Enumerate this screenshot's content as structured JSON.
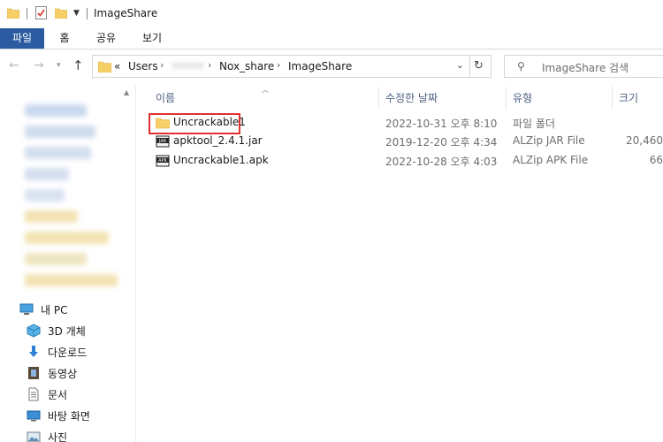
{
  "window": {
    "title": "ImageShare"
  },
  "ribbon": {
    "tabs": [
      "파일",
      "홈",
      "공유",
      "보기"
    ]
  },
  "address": {
    "overflow": "«",
    "crumbs": [
      "Users",
      "•••••",
      "Nox_share",
      "ImageShare"
    ],
    "separator": "›"
  },
  "search": {
    "placeholder": "ImageShare 검색"
  },
  "columns": {
    "name": "이름",
    "date": "수정한 날짜",
    "type": "유형",
    "size": "크기"
  },
  "files": [
    {
      "name": "Uncrackable1",
      "date": "2022-10-31 오후 8:10",
      "type": "파일 폴더",
      "size": "",
      "icon": "folder-icon"
    },
    {
      "name": "apktool_2.4.1.jar",
      "date": "2019-12-20 오후 4:34",
      "type": "ALZip JAR File",
      "size": "20,460",
      "icon": "jar-file-icon"
    },
    {
      "name": "Uncrackable1.apk",
      "date": "2022-10-28 오후 4:03",
      "type": "ALZip APK File",
      "size": "66",
      "icon": "apk-file-icon"
    }
  ],
  "navpane": {
    "this_pc": "내 PC",
    "items": [
      {
        "label": "3D 개체",
        "icon": "3d-objects-icon"
      },
      {
        "label": "다운로드",
        "icon": "downloads-icon"
      },
      {
        "label": "동영상",
        "icon": "videos-icon"
      },
      {
        "label": "문서",
        "icon": "documents-icon"
      },
      {
        "label": "바탕 화면",
        "icon": "desktop-icon"
      },
      {
        "label": "사진",
        "icon": "pictures-icon"
      }
    ]
  },
  "colors": {
    "file_tab_bg": "#2a5aa0",
    "highlight": "#e03030",
    "folder": "#f6cf66",
    "column_header": "#4d6082"
  }
}
